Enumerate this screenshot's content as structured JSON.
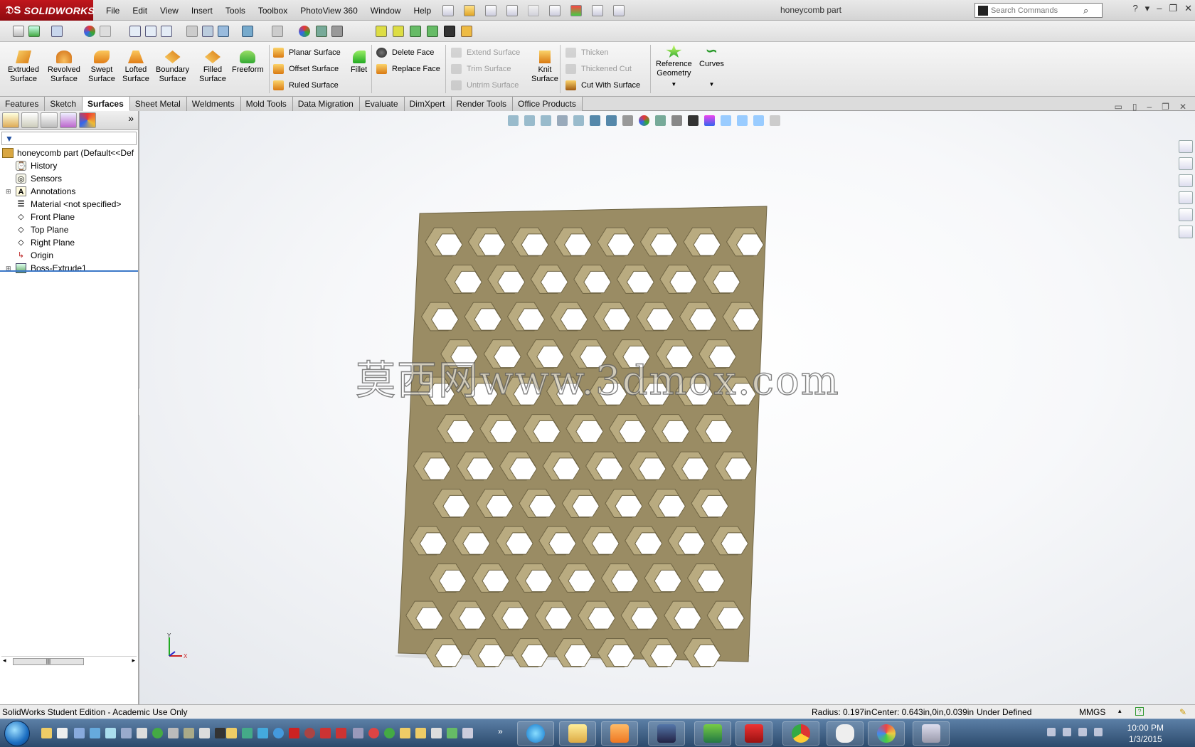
{
  "app": {
    "logo": "SOLIDWORKS",
    "document_title": "honeycomb part",
    "menus": [
      "File",
      "Edit",
      "View",
      "Insert",
      "Tools",
      "Toolbox",
      "PhotoView 360",
      "Window",
      "Help"
    ],
    "search_placeholder": "Search Commands"
  },
  "ribbon": {
    "big_buttons": [
      {
        "line1": "Extruded",
        "line2": "Surface",
        "icon": "extruded-surface-icon"
      },
      {
        "line1": "Revolved",
        "line2": "Surface",
        "icon": "revolved-surface-icon"
      },
      {
        "line1": "Swept",
        "line2": "Surface",
        "icon": "swept-surface-icon"
      },
      {
        "line1": "Lofted",
        "line2": "Surface",
        "icon": "lofted-surface-icon"
      },
      {
        "line1": "Boundary",
        "line2": "Surface",
        "icon": "boundary-surface-icon"
      },
      {
        "line1": "Filled",
        "line2": "Surface",
        "icon": "filled-surface-icon"
      },
      {
        "line1": "Freeform",
        "line2": "",
        "icon": "freeform-icon"
      }
    ],
    "planar_surface": "Planar Surface",
    "offset_surface": "Offset Surface",
    "ruled_surface": "Ruled Surface",
    "fillet": "Fillet",
    "delete_face": "Delete Face",
    "replace_face": "Replace Face",
    "extend_surface": "Extend Surface",
    "trim_surface": "Trim Surface",
    "untrim_surface": "Untrim Surface",
    "knit_line1": "Knit",
    "knit_line2": "Surface",
    "thicken": "Thicken",
    "thickened_cut": "Thickened Cut",
    "cut_with_surface": "Cut With Surface",
    "ref_geo_line1": "Reference",
    "ref_geo_line2": "Geometry",
    "curves": "Curves"
  },
  "tabs": [
    {
      "label": "Features",
      "active": false
    },
    {
      "label": "Sketch",
      "active": false
    },
    {
      "label": "Surfaces",
      "active": true
    },
    {
      "label": "Sheet Metal",
      "active": false
    },
    {
      "label": "Weldments",
      "active": false
    },
    {
      "label": "Mold Tools",
      "active": false
    },
    {
      "label": "Data Migration",
      "active": false
    },
    {
      "label": "Evaluate",
      "active": false
    },
    {
      "label": "DimXpert",
      "active": false
    },
    {
      "label": "Render Tools",
      "active": false
    },
    {
      "label": "Office Products",
      "active": false
    }
  ],
  "feature_tree": {
    "root": "honeycomb part  (Default<<Def",
    "items": [
      {
        "label": "History",
        "icon": "history-icon",
        "expandable": false
      },
      {
        "label": "Sensors",
        "icon": "sensors-icon",
        "expandable": false
      },
      {
        "label": "Annotations",
        "icon": "annotations-icon",
        "expandable": true
      },
      {
        "label": "Material <not specified>",
        "icon": "material-icon",
        "expandable": false
      },
      {
        "label": "Front Plane",
        "icon": "plane-icon",
        "expandable": false
      },
      {
        "label": "Top Plane",
        "icon": "plane-icon",
        "expandable": false
      },
      {
        "label": "Right Plane",
        "icon": "plane-icon",
        "expandable": false
      },
      {
        "label": "Origin",
        "icon": "origin-icon",
        "expandable": false
      },
      {
        "label": "Boss-Extrude1",
        "icon": "boss-extrude-icon",
        "expandable": true
      }
    ]
  },
  "viewport": {
    "watermark": "莫西网www.3dmox.com",
    "triad_x": "X",
    "triad_y": "Y",
    "model_color": "#9a8c64"
  },
  "statusbar": {
    "edition": "SolidWorks Student Edition - Academic Use Only",
    "radius": "Radius: 0.197in",
    "center": "Center: 0.643in,0in,0.039in",
    "state": "Under Defined",
    "units": "MMGS"
  },
  "taskbar": {
    "time": "10:00 PM",
    "date": "1/3/2015"
  },
  "colors": {
    "accent": "#c0161c",
    "model": "#9a8c64",
    "model_dark": "#6f6443",
    "model_light": "#b9ab80"
  }
}
